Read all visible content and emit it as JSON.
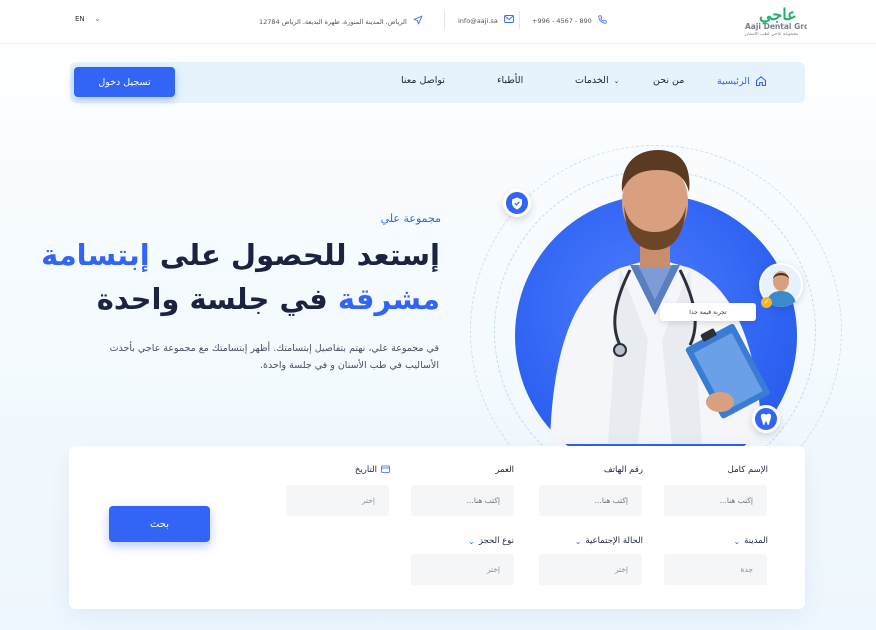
{
  "topbar": {
    "language": "EN",
    "phone": "890 - 4567 - 996+",
    "email": "info@aaji.sa",
    "address": "الرياض، المدينة المنورة، ظهرة البديعة، الرياض 12784"
  },
  "logo": {
    "mark": "عاجي",
    "name_en": "Aaji Dental Group",
    "name_ar": "مجموعة عاجي لطب الأسنان"
  },
  "nav": {
    "home": "الرئيسية",
    "about": "من نحن",
    "services": "الخدمات",
    "doctors": "الأطباء",
    "contact": "تواصل معنا",
    "login": "تسجيل دخول"
  },
  "hero": {
    "eyebrow": "مجموعة علي",
    "title_line1_main": "إستعد للحصول على ",
    "title_line1_highlight": "إبتسامة",
    "title_line2_highlight": "مشرقة",
    "title_line2_main": " في جلسة واحدة",
    "description": "في مجموعة علي، نهتم بتفاصيل إبتسامتك. أظهر إبتسامتك مع مجموعة عاجي بأحدث الأساليب في طب الأسنان و في جلسة واحدة.",
    "review_text": "تجربة قيمة جدا"
  },
  "form": {
    "fields": {
      "full_name": {
        "label": "الإسم كامل",
        "placeholder": "إكتب هنا..."
      },
      "phone": {
        "label": "رقم الهاتف",
        "placeholder": "إكتب هنا..."
      },
      "age": {
        "label": "العمر",
        "placeholder": "إكتب هنا..."
      },
      "date": {
        "label": "التاريخ",
        "placeholder": "إختر"
      },
      "city": {
        "label": "المدينة",
        "value": "جدة"
      },
      "marital": {
        "label": "الحالة الإجتماعية",
        "value": "إختر"
      },
      "booking": {
        "label": "نوع الحجز",
        "value": "إختر"
      }
    },
    "search_label": "بحث"
  },
  "colors": {
    "accent": "#3264f5",
    "logo_green": "#23b070",
    "nav_bg": "#e6f3fc"
  }
}
